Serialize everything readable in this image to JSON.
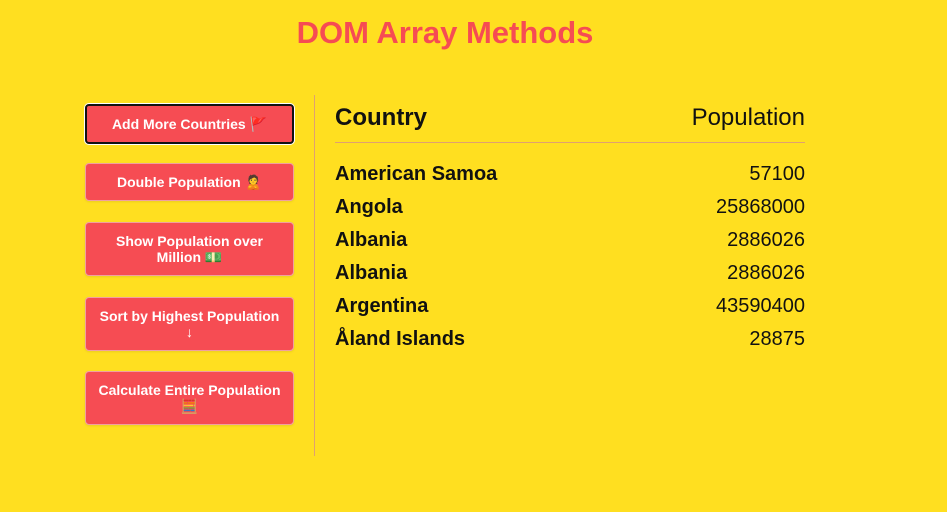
{
  "title": "DOM Array Methods",
  "buttons": [
    {
      "label": "Add More Countries",
      "icon": "🚩"
    },
    {
      "label": "Double Population",
      "icon": "🙎"
    },
    {
      "label": "Show Population over Million",
      "icon": "💵"
    },
    {
      "label": "Sort by Highest Population",
      "icon": "↓"
    },
    {
      "label": "Calculate Entire Population",
      "icon": "🧮"
    }
  ],
  "table": {
    "headers": {
      "country": "Country",
      "population": "Population"
    },
    "rows": [
      {
        "country": "American Samoa",
        "population": "57100"
      },
      {
        "country": "Angola",
        "population": "25868000"
      },
      {
        "country": "Albania",
        "population": "2886026"
      },
      {
        "country": "Albania",
        "population": "2886026"
      },
      {
        "country": "Argentina",
        "population": "43590400"
      },
      {
        "country": "Åland Islands",
        "population": "28875"
      }
    ]
  },
  "colors": {
    "background": "#ffdf20",
    "accent": "#f64c53",
    "text": "#111111"
  }
}
